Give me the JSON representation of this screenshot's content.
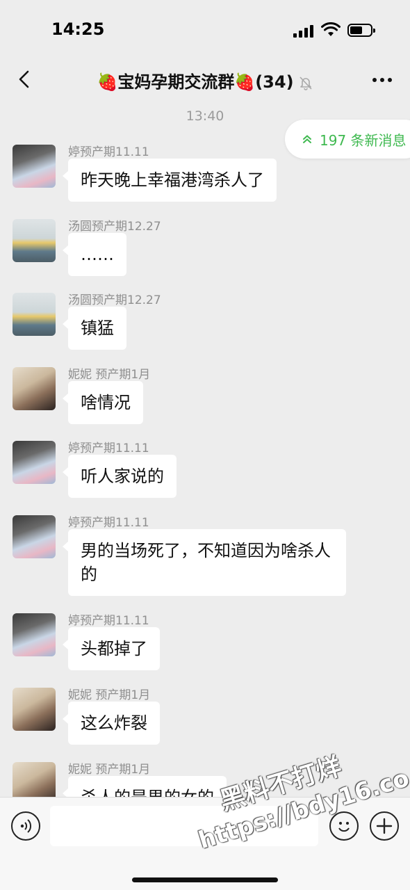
{
  "status_bar": {
    "time": "14:25"
  },
  "header": {
    "title": "🍓宝妈孕期交流群🍓",
    "member_count": "(34)"
  },
  "timestamp": "13:40",
  "new_messages_pill": {
    "label": "197 条新消息",
    "color": "#3fb950"
  },
  "messages": [
    {
      "sender": "婷预产期11.11",
      "text": "昨天晚上幸福港湾杀人了",
      "avatar": "avatar-ting"
    },
    {
      "sender": "汤圆预产期12.27",
      "text": "……",
      "avatar": "avatar-tangyuan"
    },
    {
      "sender": "汤圆预产期12.27",
      "text": "镇猛",
      "avatar": "avatar-tangyuan"
    },
    {
      "sender": "妮妮 预产期1月",
      "text": "啥情况",
      "avatar": "avatar-nini"
    },
    {
      "sender": "婷预产期11.11",
      "text": "听人家说的",
      "avatar": "avatar-ting"
    },
    {
      "sender": "婷预产期11.11",
      "text": "男的当场死了，不知道因为啥杀人的",
      "avatar": "avatar-ting"
    },
    {
      "sender": "婷预产期11.11",
      "text": "头都掉了",
      "avatar": "avatar-ting"
    },
    {
      "sender": "妮妮 预产期1月",
      "text": "这么炸裂",
      "avatar": "avatar-nini"
    },
    {
      "sender": "妮妮 预产期1月",
      "text": "杀人的是男的女的",
      "avatar": "avatar-nini"
    }
  ],
  "watermark": {
    "line1": "黑料不打烊",
    "line2": "https://bdy16.co"
  },
  "icons": {
    "back": "chevron-left-icon",
    "mute": "bell-off-icon",
    "more": "more-dots-icon",
    "voice": "voice-icon",
    "emoji": "emoji-icon",
    "plus": "plus-icon"
  }
}
